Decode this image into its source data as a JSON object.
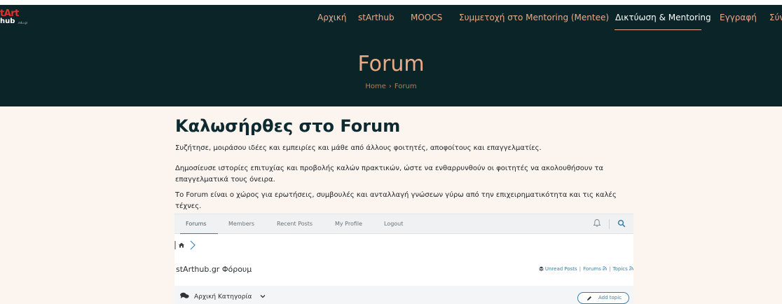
{
  "site": {
    "logo_line1": "tArt",
    "logo_line2": "hub",
    "logo_line3": ".edu.gr"
  },
  "nav": {
    "items": [
      {
        "label": "Αρχική"
      },
      {
        "label": "stArthub"
      },
      {
        "label": "MOOCS"
      },
      {
        "label": "Συμμετοχή στο Mentoring (Mentee)"
      },
      {
        "label": "Δικτύωση & Mentoring"
      },
      {
        "label": "Εγγραφή"
      },
      {
        "label": "Σύν"
      }
    ],
    "active_index": 4
  },
  "hero": {
    "title": "Forum",
    "breadcrumb_home": "Home",
    "breadcrumb_sep": "›",
    "breadcrumb_current": "Forum"
  },
  "intro": {
    "heading": "Καλωσήρθες στο Forum",
    "p1": "Συζήτησε, μοιράσου ιδέες και εμπειρίες και μάθε από άλλους φοιτητές, αποφοίτους και επαγγελματίες.",
    "p2": "Δημοσίευσε ιστορίες επιτυχίας και προβολής καλών πρακτικών, ώστε να ενθαρρυνθούν οι φοιτητές να ακολουθήσουν τα επαγγελματικά τους όνειρα.",
    "p3": "Το Forum είναι ο χώρος για ερωτήσεις, συμβουλές και ανταλλαγή γνώσεων γύρω από την επιχειρηματικότητα και τις καλές τέχνες."
  },
  "forum": {
    "tabs": [
      {
        "label": "Forums"
      },
      {
        "label": "Members"
      },
      {
        "label": "Recent Posts"
      },
      {
        "label": "My Profile"
      },
      {
        "label": "Logout"
      }
    ],
    "active_tab": 0,
    "title": "stArthub.gr Φόρουμ",
    "link_unread": "Unread Posts",
    "link_forums": "Forums",
    "link_topics": "Topics",
    "category_label": "Αρχική Κατηγορία",
    "add_topic": "Add topic"
  },
  "colors": {
    "hero_bg": "#0b2428",
    "accent": "#e8ab88",
    "page_bg": "#fbf4ef",
    "forum_link": "#3d7ea6"
  },
  "icons": [
    "home-icon",
    "chevron-right-icon",
    "bell-icon",
    "search-icon",
    "chat-bubbles-icon",
    "chevron-down-icon",
    "pencil-icon",
    "rss-icon",
    "stack-icon"
  ]
}
